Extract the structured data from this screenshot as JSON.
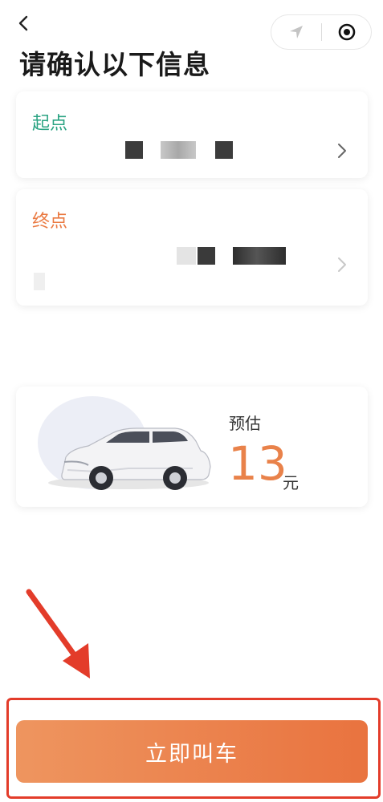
{
  "header": {
    "back_icon": "chevron-left-icon",
    "capsule": {
      "left_icon": "navigation-arrow-icon",
      "right_icon": "record-target-icon"
    }
  },
  "page_title": "请确认以下信息",
  "origin": {
    "label": "起点",
    "label_color": "#2aa382",
    "chevron_icon": "chevron-right-icon"
  },
  "destination": {
    "label": "终点",
    "label_color": "#ea7a42",
    "chevron_icon": "chevron-right-icon"
  },
  "estimate": {
    "label": "预估",
    "price": "13",
    "unit": "元",
    "price_color": "#e9824a",
    "illustration": "car-illustration"
  },
  "action": {
    "call_button_label": "立即叫车",
    "button_color": "#ec8049"
  },
  "annotation": {
    "arrow_color": "#e33c2a",
    "box_color": "#e33c2a"
  }
}
